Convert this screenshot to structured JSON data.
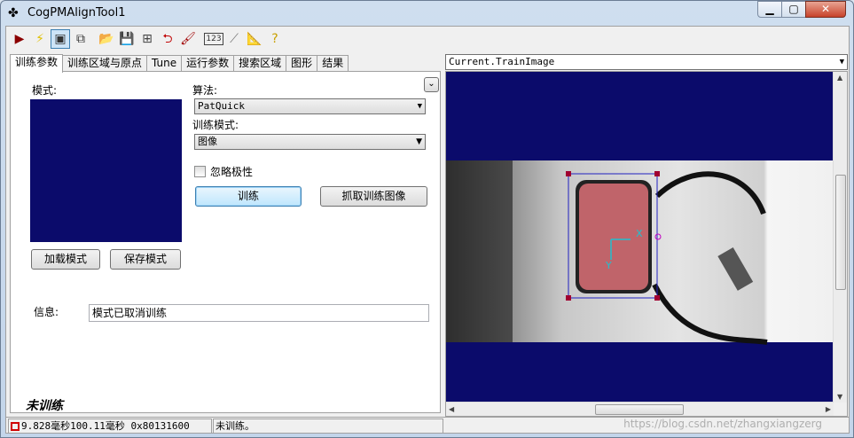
{
  "window": {
    "title": "CogPMAlignTool1",
    "title_icon": "puzzle-icon"
  },
  "toolbar": {
    "buttons": [
      {
        "name": "run-icon",
        "glyph": "▶",
        "color": "#8b0000"
      },
      {
        "name": "electric-icon",
        "glyph": "⚡",
        "color": "#e0c000"
      },
      {
        "name": "display-toggle-icon",
        "glyph": "▣",
        "color": "#333333",
        "pressed": true
      },
      {
        "name": "floating-window-icon",
        "glyph": "⧉",
        "color": "#333333"
      },
      {
        "name": "open-folder-icon",
        "glyph": "📂",
        "color": "#c89b2c"
      },
      {
        "name": "save-icon",
        "glyph": "💾",
        "color": "#222222"
      },
      {
        "name": "tool-tree-icon",
        "glyph": "⊞",
        "color": "#444444"
      },
      {
        "name": "reset-icon",
        "glyph": "⮌",
        "color": "#c00000"
      },
      {
        "name": "brush-icon",
        "glyph": "🖌",
        "color": "#a00000"
      },
      {
        "name": "numeric-icon",
        "glyph": "123",
        "color": "#333333"
      },
      {
        "name": "graph-icon",
        "glyph": "⟋",
        "color": "#777777"
      },
      {
        "name": "ruler-icon",
        "glyph": "📐",
        "color": "#6a4a00"
      },
      {
        "name": "help-icon",
        "glyph": "?",
        "color": "#c8a000"
      }
    ]
  },
  "tabs": [
    "训练参数",
    "训练区域与原点",
    "Tune",
    "运行参数",
    "搜索区域",
    "图形",
    "结果"
  ],
  "train_panel": {
    "pattern_label": "模式:",
    "load_button": "加载模式",
    "save_button": "保存模式",
    "algorithm_label": "算法:",
    "algorithm_value": "PatQuick",
    "train_mode_label": "训练模式:",
    "train_mode_value": "图像",
    "ignore_polarity_label": "忽略极性",
    "train_button": "训练",
    "grab_button": "抓取训练图像",
    "info_label": "信息:",
    "info_value": "模式已取消训练",
    "state_text": "未训练"
  },
  "statusbar": {
    "timing": "9.828毫秒100.11毫秒 0x80131600",
    "status": "未训练。"
  },
  "display": {
    "image_source": "Current.TrainImage",
    "axis_x_label": "X",
    "axis_y_label": "Y"
  },
  "watermark": "https://blog.csdn.net/zhangxiangzerg"
}
